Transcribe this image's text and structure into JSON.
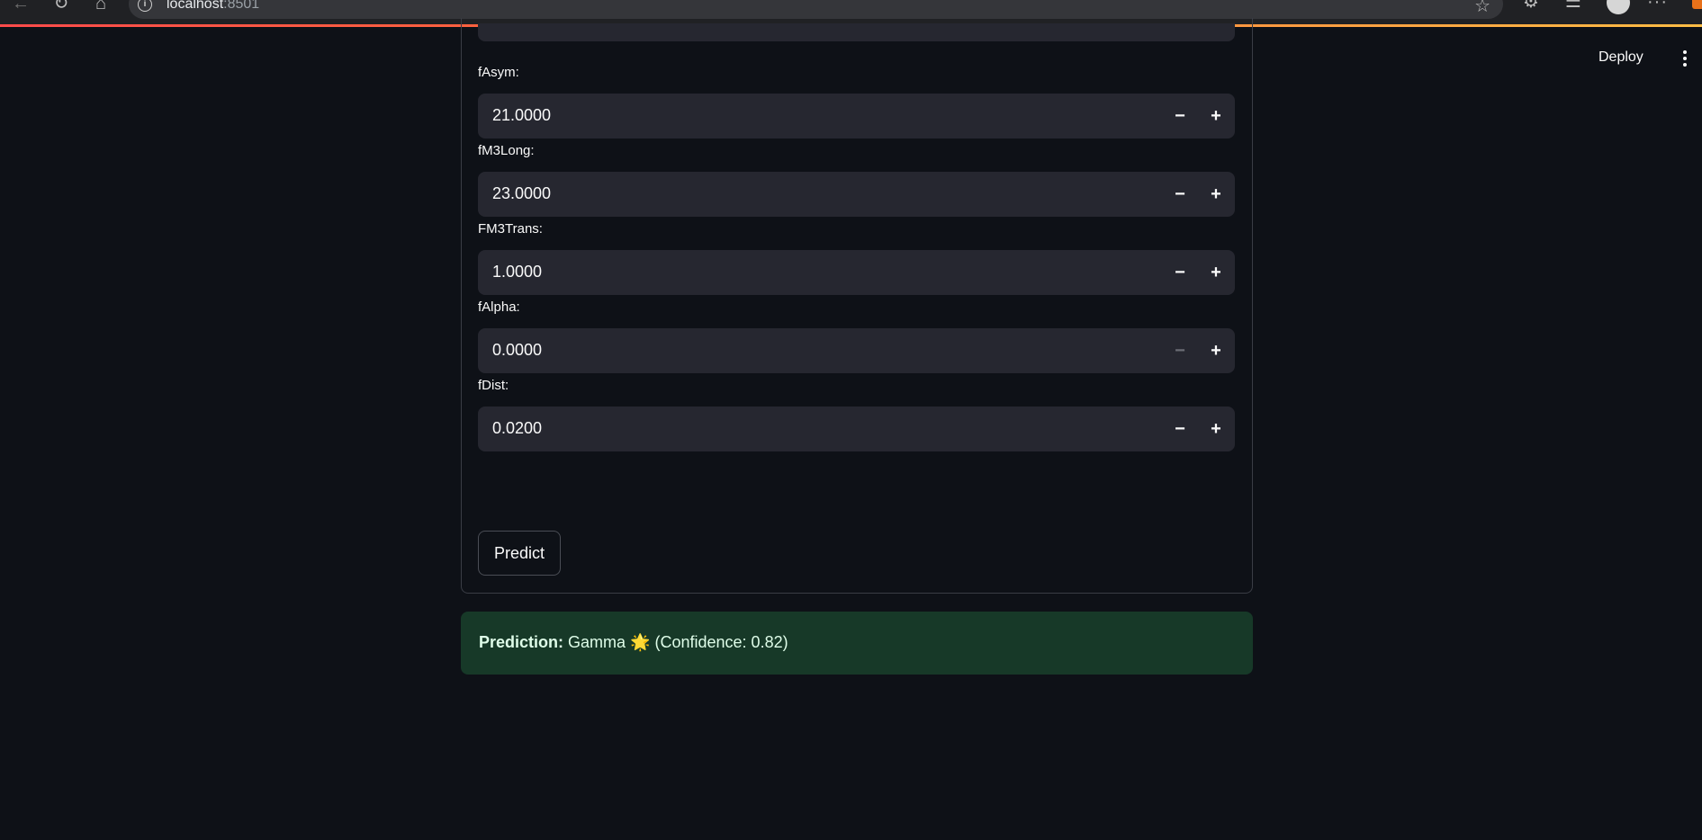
{
  "browser": {
    "url_host": "localhost",
    "url_port": ":8501"
  },
  "header": {
    "deploy_label": "Deploy"
  },
  "form": {
    "fields": [
      {
        "label": "fAsym:",
        "value": "21.0000",
        "minus_enabled": true
      },
      {
        "label": "fM3Long:",
        "value": "23.0000",
        "minus_enabled": true
      },
      {
        "label": "FM3Trans:",
        "value": "1.0000",
        "minus_enabled": true
      },
      {
        "label": "fAlpha:",
        "value": "0.0000",
        "minus_enabled": false
      },
      {
        "label": "fDist:",
        "value": "0.0200",
        "minus_enabled": true
      }
    ],
    "minus_glyph": "−",
    "plus_glyph": "+",
    "submit_label": "Predict"
  },
  "result": {
    "prefix": "Prediction:",
    "class_name": "Gamma",
    "icon": "🌟",
    "confidence_text": "(Confidence: 0.82)"
  },
  "colors": {
    "background": "#0e1117",
    "input_background": "#262730",
    "success_background": "#173928",
    "accent_line": "#ff4b4b"
  }
}
